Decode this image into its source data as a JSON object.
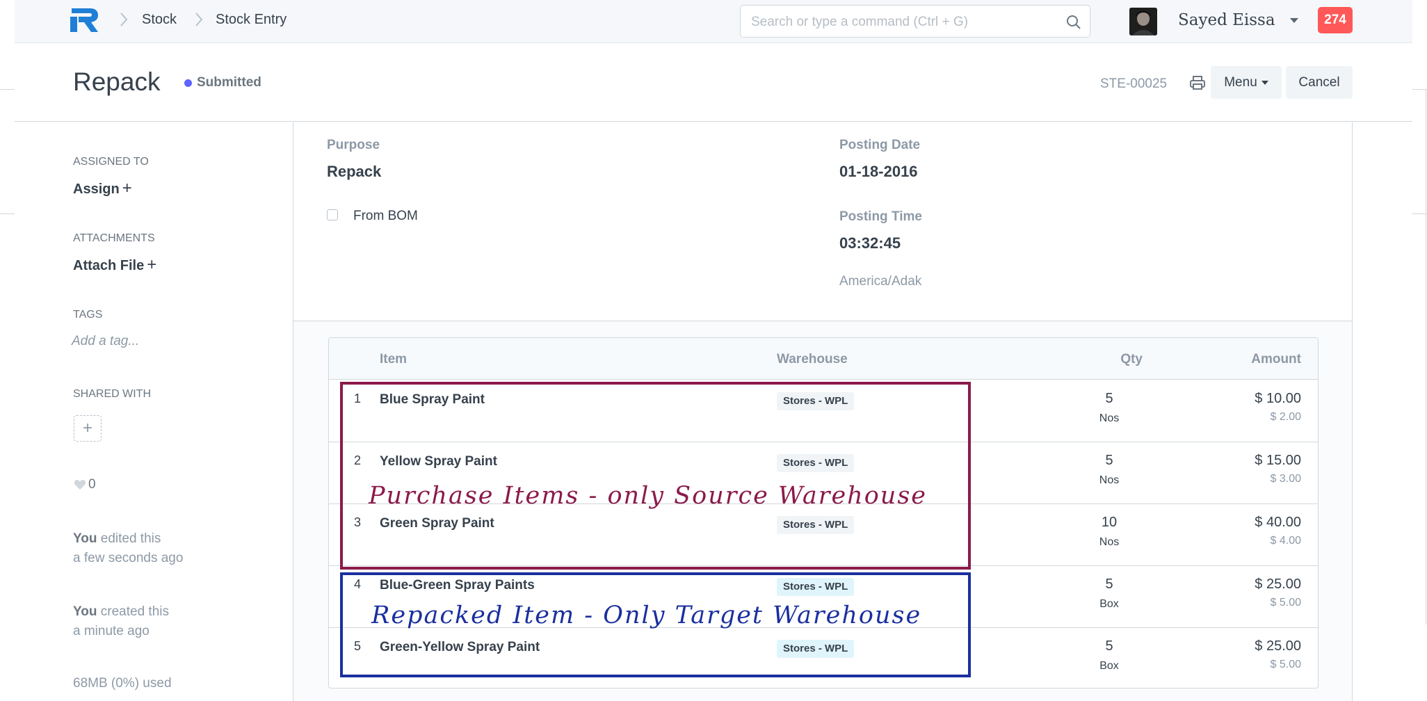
{
  "nav": {
    "breadcrumbs": [
      "Stock",
      "Stock Entry"
    ],
    "search_placeholder": "Search or type a command (Ctrl + G)",
    "user_name": "Sayed Eissa",
    "notification_count": "274"
  },
  "header": {
    "title": "Repack",
    "status": "Submitted",
    "doc_name": "STE-00025",
    "menu_label": "Menu",
    "cancel_label": "Cancel"
  },
  "sidebar": {
    "assigned_to_label": "ASSIGNED TO",
    "assign_action": "Assign",
    "attachments_label": "ATTACHMENTS",
    "attach_action": "Attach File",
    "tags_label": "TAGS",
    "tags_placeholder": "Add a tag...",
    "shared_with_label": "SHARED WITH",
    "likes": "0",
    "activity": [
      {
        "who": "You",
        "what": "edited this",
        "when": "a few seconds ago"
      },
      {
        "who": "You",
        "what": "created this",
        "when": "a minute ago"
      }
    ],
    "usage": "68MB (0%) used"
  },
  "form": {
    "purpose_label": "Purpose",
    "purpose_value": "Repack",
    "from_bom_label": "From BOM",
    "posting_date_label": "Posting Date",
    "posting_date_value": "01-18-2016",
    "posting_time_label": "Posting Time",
    "posting_time_value": "03:32:45",
    "timezone": "America/Adak"
  },
  "items_table": {
    "columns": [
      "Item",
      "Warehouse",
      "Qty",
      "Amount"
    ],
    "rows": [
      {
        "idx": "1",
        "item": "Blue Spray Paint",
        "warehouse": "Stores - WPL",
        "qty": "5",
        "uom": "Nos",
        "amount": "$ 10.00",
        "rate": "$ 2.00"
      },
      {
        "idx": "2",
        "item": "Yellow Spray Paint",
        "warehouse": "Stores - WPL",
        "qty": "5",
        "uom": "Nos",
        "amount": "$ 15.00",
        "rate": "$ 3.00"
      },
      {
        "idx": "3",
        "item": "Green Spray Paint",
        "warehouse": "Stores - WPL",
        "qty": "10",
        "uom": "Nos",
        "amount": "$ 40.00",
        "rate": "$ 4.00"
      },
      {
        "idx": "4",
        "item": "Blue-Green Spray Paints",
        "warehouse": "Stores - WPL",
        "qty": "5",
        "uom": "Box",
        "amount": "$ 25.00",
        "rate": "$ 5.00"
      },
      {
        "idx": "5",
        "item": "Green-Yellow Spray Paint",
        "warehouse": "Stores - WPL",
        "qty": "5",
        "uom": "Box",
        "amount": "$ 25.00",
        "rate": "$ 5.00"
      }
    ]
  },
  "annotations": {
    "source": "Purchase Items - only Source Warehouse",
    "target": "Repacked Item - Only Target Warehouse"
  },
  "colors": {
    "status_dot": "#5e64ff",
    "notification": "#ff5858",
    "source_annotation": "#8b1a4a",
    "target_annotation": "#1a2f9e",
    "source_warehouse_pill": "#f0f4f7",
    "target_warehouse_pill": "#e0f4fb"
  }
}
